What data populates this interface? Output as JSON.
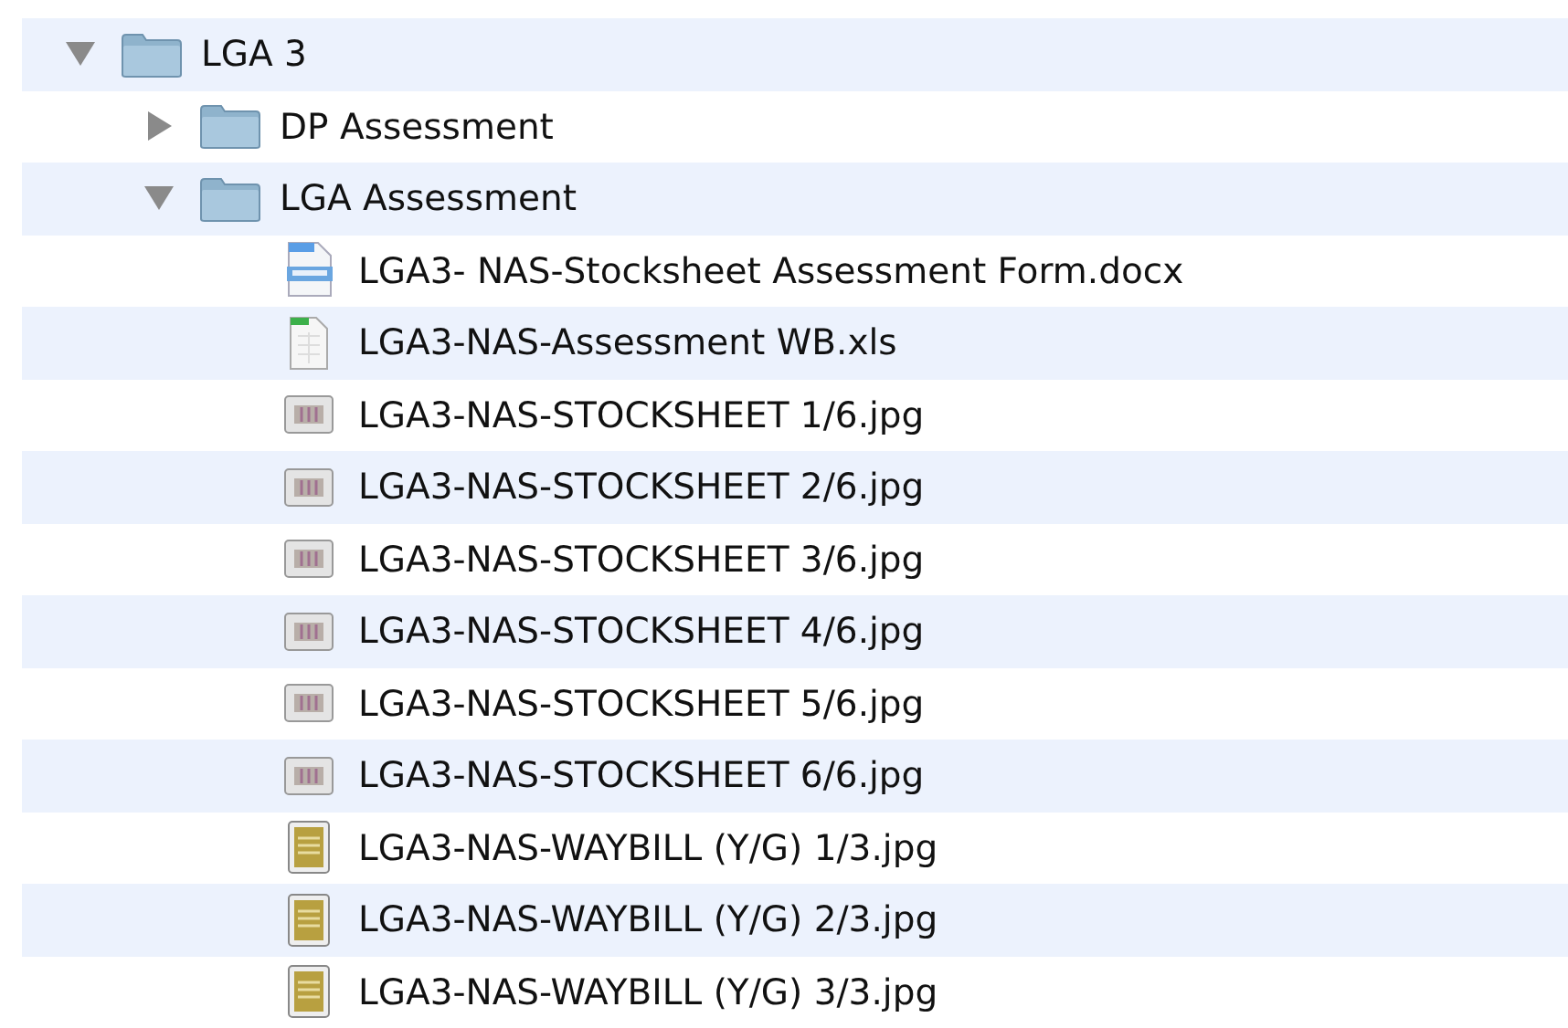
{
  "tree": [
    {
      "kind": "folder",
      "name": "LGA 3",
      "expanded": true,
      "children": [
        {
          "kind": "folder",
          "name": "DP Assessment",
          "expanded": false
        },
        {
          "kind": "folder",
          "name": "LGA Assessment",
          "expanded": true,
          "children": [
            {
              "kind": "docx",
              "name": "LGA3- NAS-Stocksheet Assessment Form.docx"
            },
            {
              "kind": "xls",
              "name": "LGA3-NAS-Assessment WB.xls"
            },
            {
              "kind": "sheet-image",
              "name": "LGA3-NAS-STOCKSHEET 1/6.jpg"
            },
            {
              "kind": "sheet-image",
              "name": "LGA3-NAS-STOCKSHEET 2/6.jpg"
            },
            {
              "kind": "sheet-image",
              "name": "LGA3-NAS-STOCKSHEET 3/6.jpg"
            },
            {
              "kind": "sheet-image",
              "name": "LGA3-NAS-STOCKSHEET 4/6.jpg"
            },
            {
              "kind": "sheet-image",
              "name": "LGA3-NAS-STOCKSHEET 5/6.jpg"
            },
            {
              "kind": "sheet-image",
              "name": "LGA3-NAS-STOCKSHEET 6/6.jpg"
            },
            {
              "kind": "waybill-image",
              "name": "LGA3-NAS-WAYBILL (Y/G) 1/3.jpg"
            },
            {
              "kind": "waybill-image",
              "name": "LGA3-NAS-WAYBILL (Y/G) 2/3.jpg"
            },
            {
              "kind": "waybill-image",
              "name": "LGA3-NAS-WAYBILL (Y/G) 3/3.jpg"
            }
          ]
        }
      ]
    }
  ]
}
